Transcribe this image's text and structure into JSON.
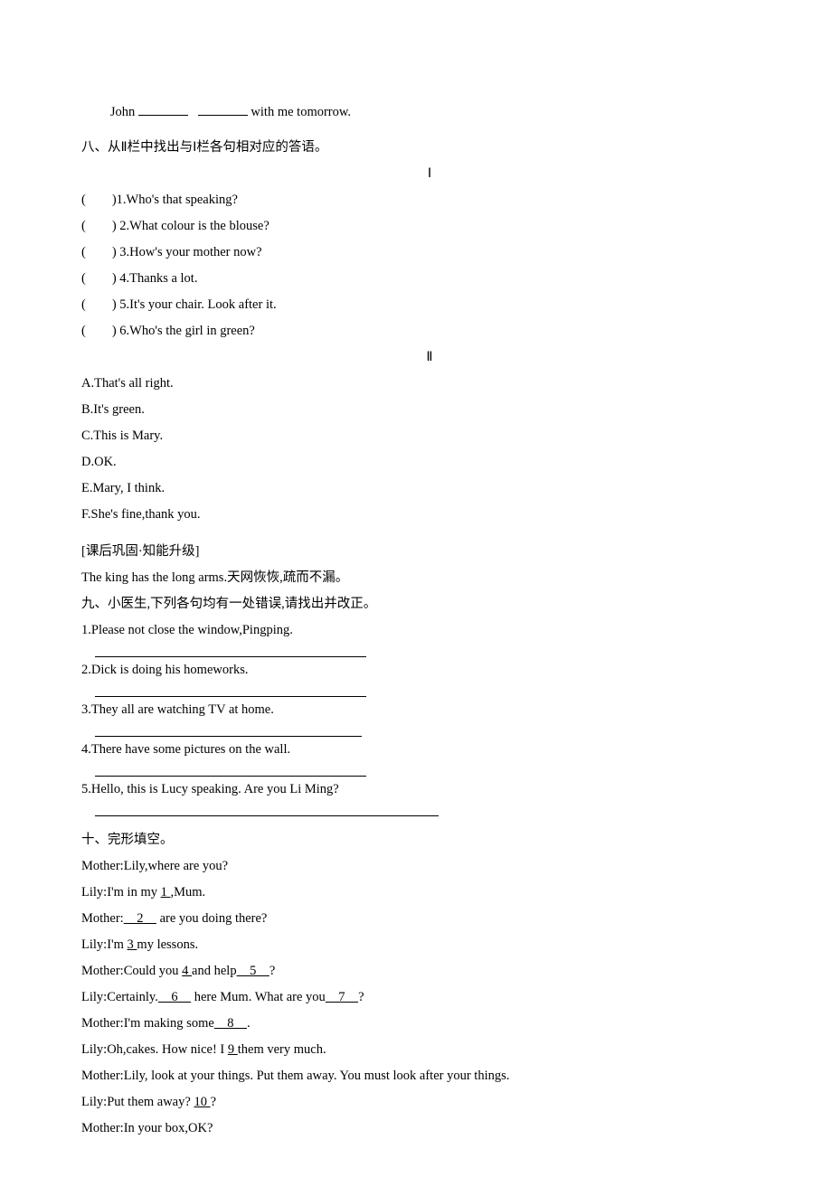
{
  "topline": {
    "prefix": "John ",
    "suffix": " with me tomorrow."
  },
  "section8": {
    "heading": "八、从Ⅱ栏中找出与Ⅰ栏各句相对应的答语。",
    "roman1": "Ⅰ",
    "items": [
      "(　　)1.Who's that speaking?",
      "(　　) 2.What colour is the blouse?",
      "(　　) 3.How's your mother now?",
      "(　　) 4.Thanks a lot.",
      "(　　) 5.It's your chair. Look after it.",
      "(　　) 6.Who's the girl in green?"
    ],
    "roman2": "Ⅱ",
    "answers": [
      "A.That's all right.",
      "B.It's green.",
      "C.This is Mary.",
      "D.OK.",
      "E.Mary, I think.",
      "F.She's fine,thank you."
    ]
  },
  "supplement": {
    "line1": "[课后巩固·知能升级]",
    "line2": "The king has the long arms.天网恢恢,疏而不漏。"
  },
  "section9": {
    "heading": "九、小医生,下列各句均有一处错误,请找出并改正。",
    "items": [
      "1.Please not close the window,Pingping.",
      "2.Dick is doing his homeworks.",
      "3.They all are watching TV at home.",
      "4.There have some pictures on the wall.",
      "5.Hello, this is Lucy speaking. Are you Li Ming?"
    ],
    "line_widths": [
      300,
      300,
      295,
      300,
      380
    ]
  },
  "section10": {
    "heading": "十、完形填空。",
    "lines": {
      "l1a": "Mother:Lily,where are you?",
      "l2a": "Lily:I'm in my ",
      "l2b": " 1 ",
      "l2c": " ,Mum.",
      "l3a": "Mother:",
      "l3b": "　2　",
      "l3c": " are you doing there?",
      "l4a": "Lily:I'm ",
      "l4b": " 3 ",
      "l4c": " my lessons.",
      "l5a": "Mother:Could you ",
      "l5b": " 4 ",
      "l5c": " and help",
      "l5d": "　5　",
      "l5e": "?",
      "l6a": "Lily:Certainly.",
      "l6b": "　6　",
      "l6c": " here Mum. What are you",
      "l6d": "　7　",
      "l6e": "?",
      "l7a": "Mother:I'm making some",
      "l7b": "　8　",
      "l7c": ".",
      "l8a": "Lily:Oh,cakes. How nice! I ",
      "l8b": " 9 ",
      "l8c": " them very much.",
      "l9a": "Mother:Lily, look at your things. Put them away. You must look after your things.",
      "l10a": "Lily:Put them away? ",
      "l10b": " 10 ",
      "l10c": " ?",
      "l11a": "Mother:In your box,OK?"
    }
  }
}
